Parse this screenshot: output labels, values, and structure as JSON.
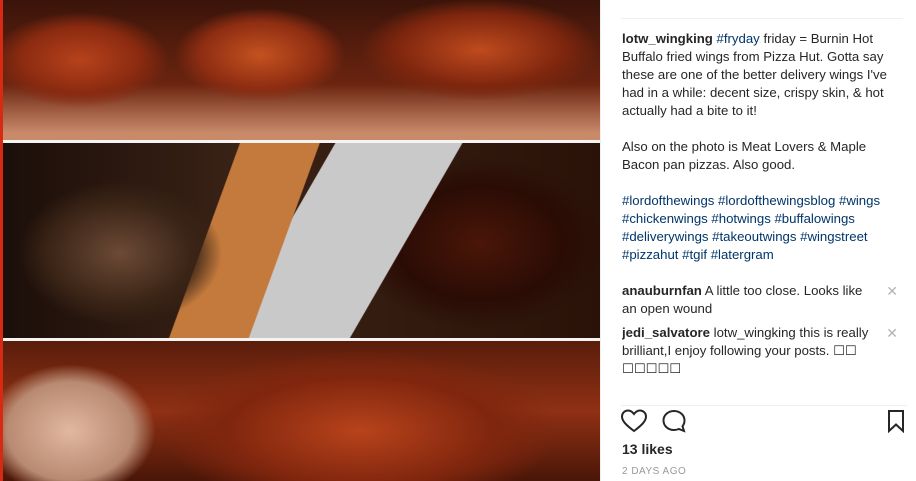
{
  "post": {
    "username": "lotw_wingking",
    "caption_tag": "#fryday",
    "caption_line1": " friday = Burnin Hot Buffalo fried wings from Pizza Hut. Gotta say these are one of the better delivery wings I've had in a while: decent size, crispy skin, & hot actually had a bite to it!",
    "caption_line2": "Also on the photo is Meat Lovers & Maple Bacon pan pizzas. Also good.",
    "hashtags": "#lordofthewings #lordofthewingsblog #wings #chickenwings #hotwings #buffalowings #deliverywings #takeoutwings #wingstreet #pizzahut #tgif #latergram"
  },
  "comments": [
    {
      "user": "anauburnfan",
      "text": "A little too close. Looks like an open wound"
    },
    {
      "user": "jedi_salvatore",
      "text": "lotw_wingking this is really brilliant,I enjoy following your posts. ☐☐ ☐☐☐☐☐"
    }
  ],
  "actions": {
    "like_icon": "heart-icon",
    "comment_icon": "comment-icon",
    "save_icon": "bookmark-icon"
  },
  "likes": "13 likes",
  "timestamp": "2 DAYS AGO",
  "colors": {
    "hashtag": "#003569",
    "accent": "#d62a12"
  }
}
